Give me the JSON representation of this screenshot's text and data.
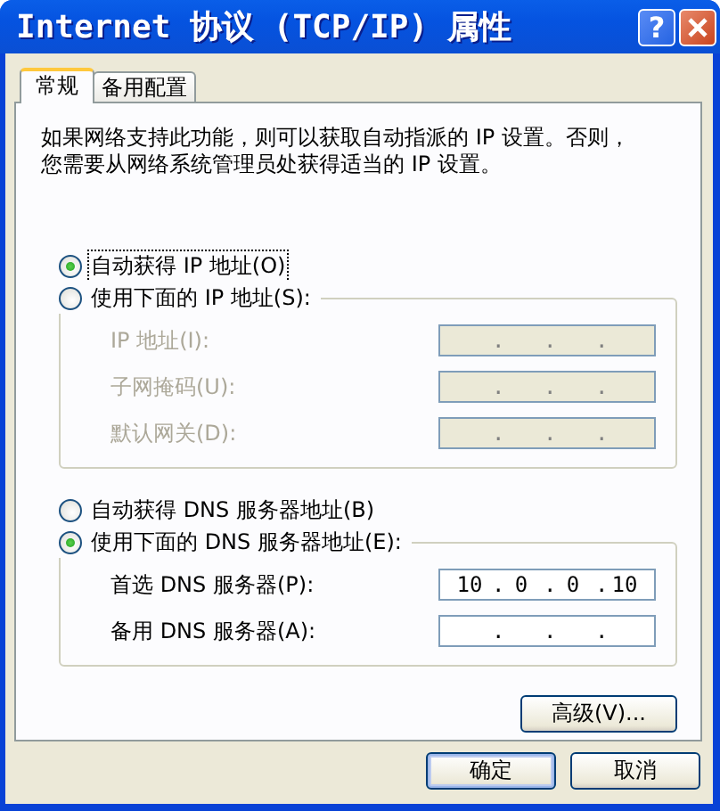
{
  "window": {
    "title": "Internet 协议 (TCP/IP) 属性",
    "help_label": "?"
  },
  "tabs": [
    {
      "label": "常规",
      "selected": true
    },
    {
      "label": "备用配置",
      "selected": false
    }
  ],
  "description": "如果网络支持此功能，则可以获取自动指派的 IP 设置。否则，您需要从网络系统管理员处获得适当的 IP 设置。",
  "ip_section": {
    "auto_option": {
      "label": "自动获得 IP 地址(O)",
      "selected": true,
      "focused": true
    },
    "manual_option": {
      "label": "使用下面的 IP 地址(S):",
      "selected": false,
      "focused": false
    },
    "fields": [
      {
        "label": "IP 地址(I):",
        "disabled": true,
        "dots": [
          ".",
          ".",
          "."
        ]
      },
      {
        "label": "子网掩码(U):",
        "disabled": true,
        "dots": [
          ".",
          ".",
          "."
        ]
      },
      {
        "label": "默认网关(D):",
        "disabled": true,
        "dots": [
          ".",
          ".",
          "."
        ]
      }
    ]
  },
  "dns_section": {
    "auto_option": {
      "label": "自动获得 DNS 服务器地址(B)",
      "selected": false,
      "focused": false
    },
    "manual_option": {
      "label": "使用下面的 DNS 服务器地址(E):",
      "selected": true,
      "focused": false
    },
    "fields": [
      {
        "label": "首选 DNS 服务器(P):",
        "disabled": false,
        "octets": [
          "10",
          "0",
          "0",
          "10"
        ],
        "dots": [
          ".",
          ".",
          "."
        ]
      },
      {
        "label": "备用 DNS 服务器(A):",
        "disabled": false,
        "dots": [
          ".",
          ".",
          "."
        ]
      }
    ]
  },
  "advanced_button": "高级(V)...",
  "buttons": [
    {
      "label": "确定",
      "default": true
    },
    {
      "label": "取消",
      "default": false
    }
  ]
}
